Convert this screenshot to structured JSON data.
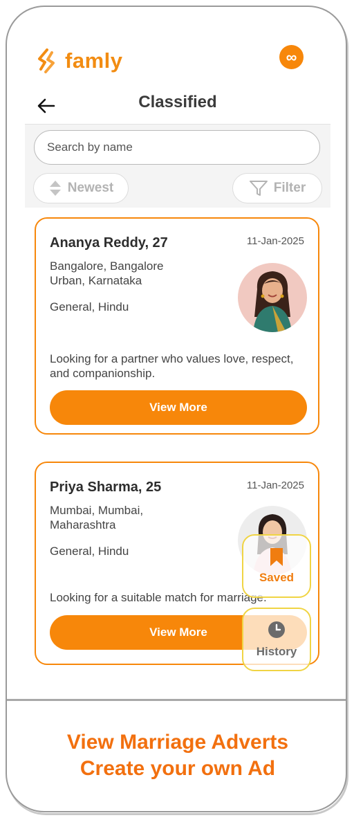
{
  "app": {
    "brand": "famly",
    "infinity_label": "∞"
  },
  "nav": {
    "title": "Classified"
  },
  "search": {
    "placeholder": "Search by name"
  },
  "sort": {
    "label": "Newest"
  },
  "filter": {
    "label": "Filter"
  },
  "profiles": [
    {
      "name": "Ananya Reddy, 27",
      "date": "11-Jan-2025",
      "location": "Bangalore, Bangalore Urban, Karnataka",
      "religion": "General, Hindu",
      "description": "Looking for a partner who values love, respect, and companionship.",
      "button_label": "View More"
    },
    {
      "name": "Priya Sharma, 25",
      "date": "11-Jan-2025",
      "location": "Mumbai, Mumbai, Maharashtra",
      "religion": "General, Hindu",
      "description": "Looking for a suitable match for marriage.",
      "button_label": "View More"
    }
  ],
  "floating": {
    "saved_label": "Saved",
    "history_label": "History"
  },
  "footer": {
    "line1": "View Marriage Adverts",
    "line2": "Create your own Ad"
  },
  "colors": {
    "accent": "#f7870a",
    "brand": "#f28c12",
    "highlight": "#f0d443"
  },
  "icons": [
    "famly-logo-icon",
    "infinity-icon",
    "back-arrow-icon",
    "sort-icon",
    "filter-icon",
    "bookmark-icon",
    "clock-icon"
  ]
}
